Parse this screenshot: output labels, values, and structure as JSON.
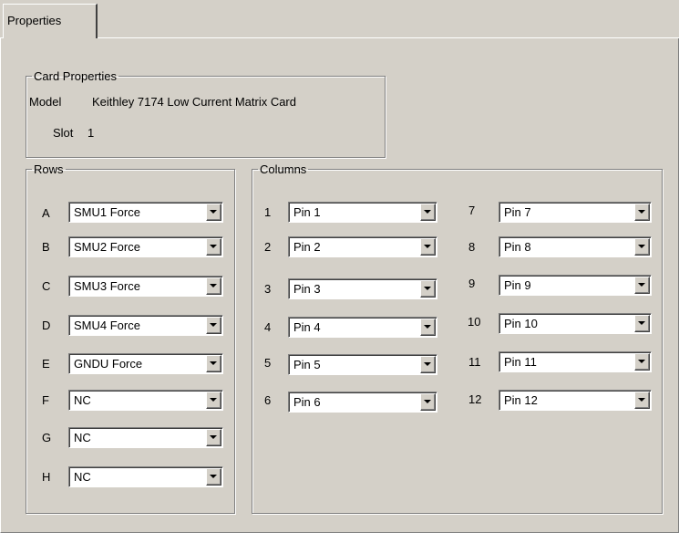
{
  "tab": {
    "label": "Properties"
  },
  "card": {
    "legend": "Card Properties",
    "model_label": "Model",
    "model_value": "Keithley 7174 Low Current Matrix Card",
    "slot_label": "Slot",
    "slot_value": "1"
  },
  "rows": {
    "legend": "Rows",
    "items": [
      {
        "label": "A",
        "value": "SMU1 Force"
      },
      {
        "label": "B",
        "value": "SMU2 Force"
      },
      {
        "label": "C",
        "value": "SMU3 Force"
      },
      {
        "label": "D",
        "value": "SMU4 Force"
      },
      {
        "label": "E",
        "value": "GNDU Force"
      },
      {
        "label": "F",
        "value": "NC"
      },
      {
        "label": "G",
        "value": "NC"
      },
      {
        "label": "H",
        "value": "NC"
      }
    ]
  },
  "columns": {
    "legend": "Columns",
    "items": [
      {
        "label": "1",
        "value": "Pin 1"
      },
      {
        "label": "2",
        "value": "Pin 2"
      },
      {
        "label": "3",
        "value": "Pin 3"
      },
      {
        "label": "4",
        "value": "Pin 4"
      },
      {
        "label": "5",
        "value": "Pin 5"
      },
      {
        "label": "6",
        "value": "Pin 6"
      },
      {
        "label": "7",
        "value": "Pin 7"
      },
      {
        "label": "8",
        "value": "Pin 8"
      },
      {
        "label": "9",
        "value": "Pin 9"
      },
      {
        "label": "10",
        "value": "Pin 10"
      },
      {
        "label": "11",
        "value": "Pin 11"
      },
      {
        "label": "12",
        "value": "Pin 12"
      }
    ]
  }
}
